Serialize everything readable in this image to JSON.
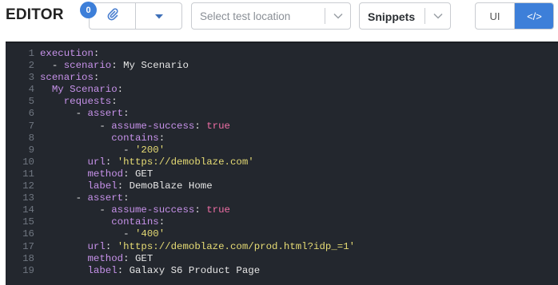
{
  "header": {
    "title": "EDITOR",
    "attachments_count": "0",
    "test_location_placeholder": "Select test location",
    "snippets_label": "Snippets",
    "view_ui_label": "UI",
    "view_code_label": "</>"
  },
  "icons": {
    "attach": "paperclip-icon",
    "attach_dropdown": "caret-down-icon",
    "location_dropdown": "chevron-down-icon",
    "snippets_dropdown": "chevron-down-icon"
  },
  "colors": {
    "accent": "#3d7fd9",
    "editor_bg": "#23272e",
    "yaml_key": "#c792ea",
    "yaml_string": "#e6db74",
    "yaml_bool": "#f06fa6",
    "line_number": "#6f7680"
  },
  "editor": {
    "lines": [
      {
        "n": "1",
        "indent": "",
        "dash": "",
        "key": "execution",
        "colon": ":",
        "val": "",
        "vtype": ""
      },
      {
        "n": "2",
        "indent": "  ",
        "dash": "- ",
        "key": "scenario",
        "colon": ": ",
        "val": "My Scenario",
        "vtype": "plain"
      },
      {
        "n": "3",
        "indent": "",
        "dash": "",
        "key": "scenarios",
        "colon": ":",
        "val": "",
        "vtype": ""
      },
      {
        "n": "4",
        "indent": "  ",
        "dash": "",
        "key": "My Scenario",
        "colon": ":",
        "val": "",
        "vtype": ""
      },
      {
        "n": "5",
        "indent": "    ",
        "dash": "",
        "key": "requests",
        "colon": ":",
        "val": "",
        "vtype": ""
      },
      {
        "n": "6",
        "indent": "      ",
        "dash": "- ",
        "key": "assert",
        "colon": ":",
        "val": "",
        "vtype": ""
      },
      {
        "n": "7",
        "indent": "          ",
        "dash": "- ",
        "key": "assume-success",
        "colon": ": ",
        "val": "true",
        "vtype": "bool"
      },
      {
        "n": "8",
        "indent": "            ",
        "dash": "",
        "key": "contains",
        "colon": ":",
        "val": "",
        "vtype": ""
      },
      {
        "n": "9",
        "indent": "              ",
        "dash": "- ",
        "key": "",
        "colon": "",
        "val": "'200'",
        "vtype": "str"
      },
      {
        "n": "10",
        "indent": "        ",
        "dash": "",
        "key": "url",
        "colon": ": ",
        "val": "'https://demoblaze.com'",
        "vtype": "str"
      },
      {
        "n": "11",
        "indent": "        ",
        "dash": "",
        "key": "method",
        "colon": ": ",
        "val": "GET",
        "vtype": "plain"
      },
      {
        "n": "12",
        "indent": "        ",
        "dash": "",
        "key": "label",
        "colon": ": ",
        "val": "DemoBlaze Home",
        "vtype": "plain"
      },
      {
        "n": "13",
        "indent": "      ",
        "dash": "- ",
        "key": "assert",
        "colon": ":",
        "val": "",
        "vtype": ""
      },
      {
        "n": "14",
        "indent": "          ",
        "dash": "- ",
        "key": "assume-success",
        "colon": ": ",
        "val": "true",
        "vtype": "bool"
      },
      {
        "n": "15",
        "indent": "            ",
        "dash": "",
        "key": "contains",
        "colon": ":",
        "val": "",
        "vtype": ""
      },
      {
        "n": "16",
        "indent": "              ",
        "dash": "- ",
        "key": "",
        "colon": "",
        "val": "'400'",
        "vtype": "str"
      },
      {
        "n": "17",
        "indent": "        ",
        "dash": "",
        "key": "url",
        "colon": ": ",
        "val": "'https://demoblaze.com/prod.html?idp_=1'",
        "vtype": "str"
      },
      {
        "n": "18",
        "indent": "        ",
        "dash": "",
        "key": "method",
        "colon": ": ",
        "val": "GET",
        "vtype": "plain"
      },
      {
        "n": "19",
        "indent": "        ",
        "dash": "",
        "key": "label",
        "colon": ": ",
        "val": "Galaxy S6 Product Page",
        "vtype": "plain"
      }
    ]
  }
}
